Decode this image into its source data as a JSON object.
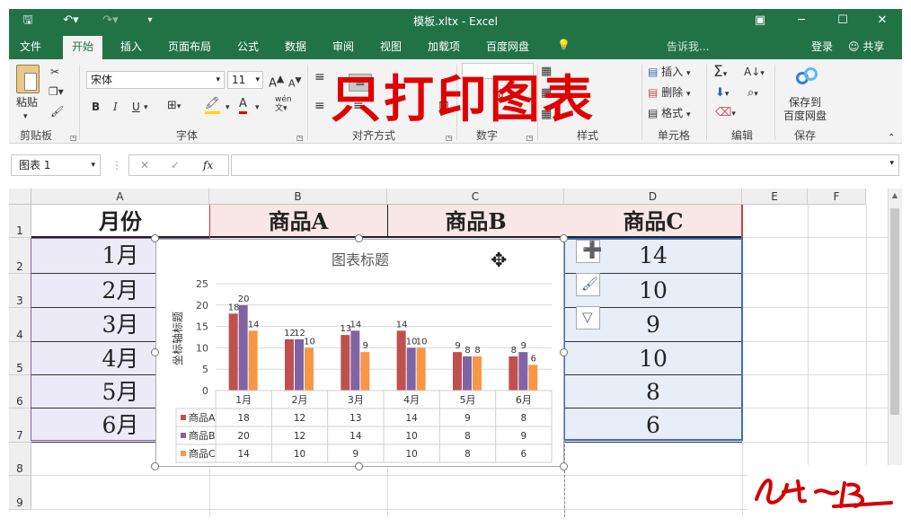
{
  "window": {
    "title": "模板.xltx - Excel"
  },
  "tabs": [
    {
      "label": "文件"
    },
    {
      "label": "开始"
    },
    {
      "label": "插入"
    },
    {
      "label": "页面布局"
    },
    {
      "label": "公式"
    },
    {
      "label": "数据"
    },
    {
      "label": "审阅"
    },
    {
      "label": "视图"
    },
    {
      "label": "加载项"
    },
    {
      "label": "百度网盘"
    }
  ],
  "tell_me": "告诉我...",
  "login": "登录",
  "share": "共享",
  "ribbon": {
    "paste": "粘贴",
    "clipboard": "剪贴板",
    "font_name": "宋体",
    "font_size": "11",
    "font_group": "字体",
    "align_group": "对齐方式",
    "number_group": "数字",
    "style_group": "样式",
    "cells_group": "单元格",
    "insert": "插入",
    "delete": "删除",
    "format": "格式",
    "edit_group": "编辑",
    "save_group": "保存",
    "save_baidu_1": "保存到",
    "save_baidu_2": "百度网盘",
    "bold": "B",
    "italic": "I",
    "underline": "U",
    "grow": "A",
    "shrink": "A",
    "wen": "wén"
  },
  "overlay_caption": "只打印图表",
  "formula": {
    "namebox": "图表 1",
    "fx": "fx"
  },
  "columns": [
    "A",
    "B",
    "C",
    "D",
    "E",
    "F"
  ],
  "rows": [
    "1",
    "2",
    "3",
    "4",
    "5",
    "6",
    "7",
    "8",
    "9"
  ],
  "table": {
    "headers": [
      "月份",
      "商品A",
      "商品B",
      "商品C"
    ],
    "months": [
      "1月",
      "2月",
      "3月",
      "4月",
      "5月",
      "6月"
    ],
    "colD": [
      "14",
      "10",
      "9",
      "10",
      "8",
      "6"
    ]
  },
  "chart_data": {
    "type": "bar",
    "title": "图表标题",
    "ylabel": "坐标轴标题",
    "categories": [
      "1月",
      "2月",
      "3月",
      "4月",
      "5月",
      "6月"
    ],
    "ylim": [
      0,
      25
    ],
    "yticks": [
      "0",
      "5",
      "10",
      "15",
      "20",
      "25"
    ],
    "series": [
      {
        "name": "商品A",
        "values": [
          18,
          12,
          13,
          14,
          9,
          8
        ],
        "color": "#c0504d"
      },
      {
        "name": "商品B",
        "values": [
          20,
          12,
          14,
          10,
          8,
          9
        ],
        "color": "#8064a2"
      },
      {
        "name": "商品C",
        "values": [
          14,
          10,
          9,
          10,
          8,
          6
        ],
        "color": "#f79646"
      }
    ]
  },
  "colors": {
    "excel_green": "#217346",
    "selection_blue": "#3c6cc4"
  }
}
